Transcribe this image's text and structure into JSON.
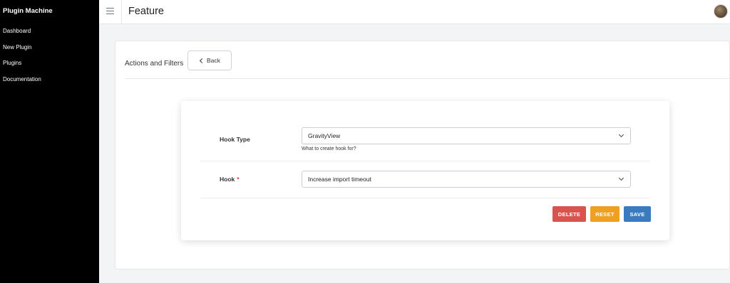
{
  "sidebar": {
    "brand": "Plugin Machine",
    "items": [
      {
        "label": "Dashboard"
      },
      {
        "label": "New Plugin"
      },
      {
        "label": "Plugins"
      },
      {
        "label": "Documentation"
      }
    ]
  },
  "header": {
    "title": "Feature",
    "menu_icon": "hamburger-icon",
    "avatar_icon": "user-avatar"
  },
  "main": {
    "section_title": "Actions and Filters",
    "back_label": "Back",
    "back_icon": "chevron-left-icon"
  },
  "form": {
    "hook_type": {
      "label": "Hook Type",
      "value": "GravityView",
      "help": "What to create hook for?"
    },
    "hook": {
      "label": "Hook",
      "required_mark": "*",
      "value": "Increase import timeout"
    },
    "actions": {
      "delete_label": "DELETE",
      "reset_label": "RESET",
      "save_label": "SAVE"
    }
  },
  "colors": {
    "sidebar_bg": "#000000",
    "delete": "#d9534f",
    "reset": "#f0a020",
    "save": "#3a7bbf",
    "required": "#dc3545"
  }
}
